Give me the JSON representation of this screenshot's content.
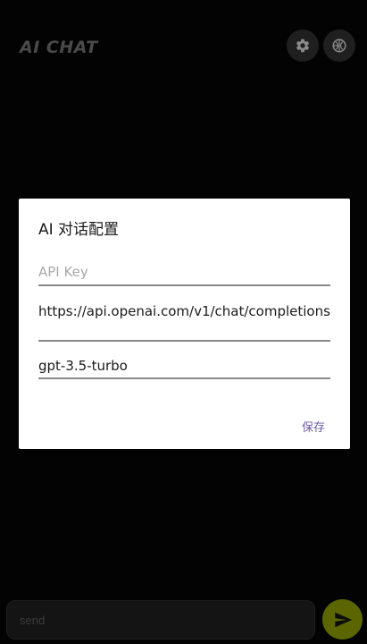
{
  "app": {
    "title": "AI CHAT"
  },
  "toolbar": {
    "settings_icon": "gear-icon",
    "history_icon": "globe-icon"
  },
  "dialog": {
    "title": "AI 对话配置",
    "api_key_placeholder": "API Key",
    "api_url_value": "https://api.openai.com/v1/chat/completions",
    "model_value": "gpt-3.5-turbo",
    "save_label": "保存"
  },
  "composer": {
    "placeholder": "send",
    "send_icon": "send-arrow-icon"
  },
  "colors": {
    "background": "#030303",
    "dialog_bg": "#ffffff",
    "accent_text": "#6b5aa3",
    "send_button": "#5b6600"
  }
}
